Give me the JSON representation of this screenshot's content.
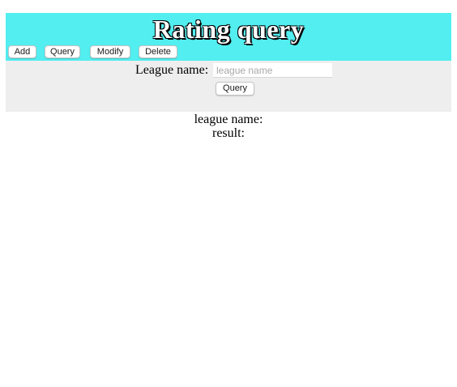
{
  "header": {
    "title": "Rating query",
    "background": "#52eef0"
  },
  "nav": {
    "add_label": "Add",
    "query_label": "Query",
    "modify_label": "Modify",
    "delete_label": "Delete"
  },
  "form": {
    "league_label": "League name:",
    "league_input_value": "",
    "league_input_placeholder": "league name",
    "submit_label": "Query",
    "panel_background": "#eeeeee"
  },
  "result": {
    "league_name_label": "league name:",
    "result_label": "result:"
  }
}
